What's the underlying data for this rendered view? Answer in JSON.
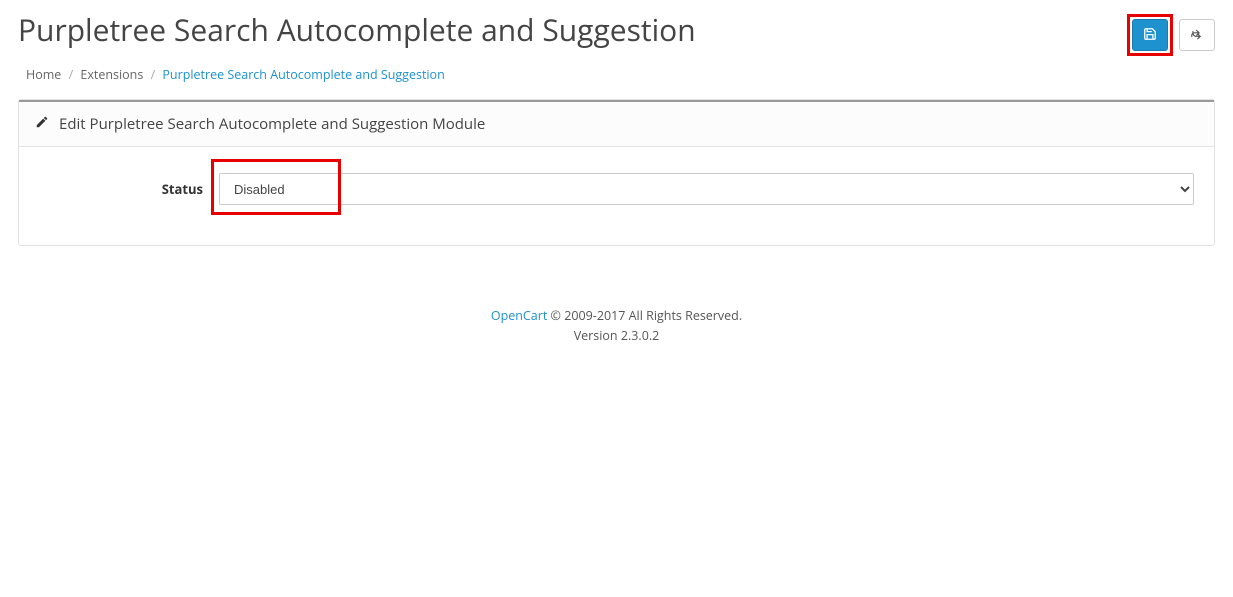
{
  "header": {
    "title": "Purpletree Search Autocomplete and Suggestion"
  },
  "breadcrumb": {
    "home": "Home",
    "extensions": "Extensions",
    "current": "Purpletree Search Autocomplete and Suggestion"
  },
  "panel": {
    "heading": "Edit Purpletree Search Autocomplete and Suggestion Module"
  },
  "form": {
    "status_label": "Status",
    "status_value": "Disabled"
  },
  "footer": {
    "brand": "OpenCart",
    "copyright": " © 2009-2017 All Rights Reserved.",
    "version": "Version 2.3.0.2"
  }
}
